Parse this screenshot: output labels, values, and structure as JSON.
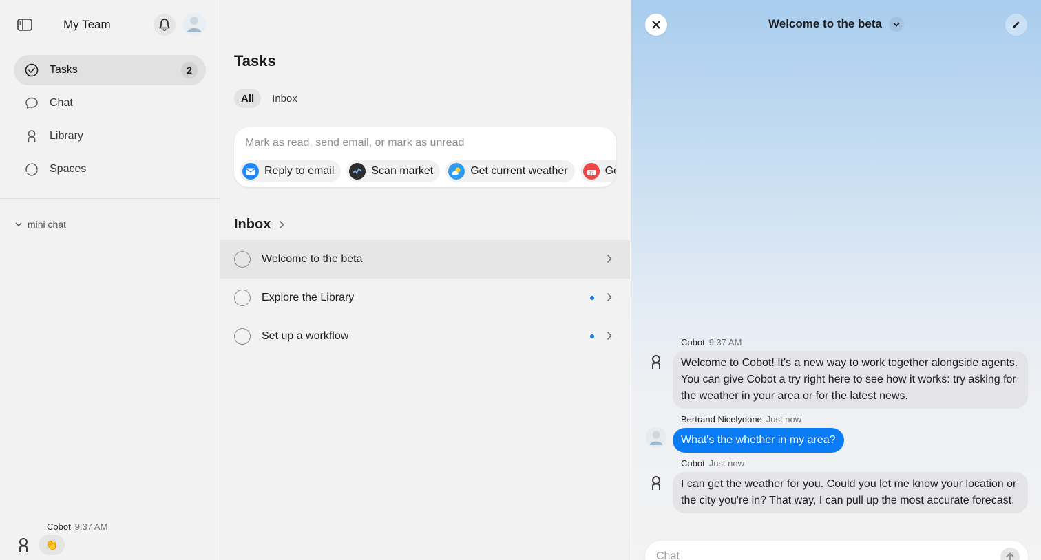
{
  "sidebar": {
    "team_name": "My Team",
    "nav": [
      {
        "label": "Tasks",
        "badge": "2"
      },
      {
        "label": "Chat"
      },
      {
        "label": "Library"
      },
      {
        "label": "Spaces"
      }
    ],
    "section_label": "mini chat",
    "last_message": {
      "sender": "Cobot",
      "time": "9:37 AM",
      "emoji": "👏"
    }
  },
  "main": {
    "title": "Tasks",
    "tabs": [
      {
        "label": "All",
        "active": true
      },
      {
        "label": "Inbox",
        "active": false
      }
    ],
    "command": {
      "placeholder": "Mark as read, send email, or mark as unread",
      "chips": [
        {
          "label": "Reply to email",
          "icon": "mail-icon",
          "color": "#1e88ff"
        },
        {
          "label": "Scan market",
          "icon": "market-icon",
          "color": "#2d2d2f"
        },
        {
          "label": "Get current weather",
          "icon": "weather-icon",
          "color": "#2f9bf0"
        },
        {
          "label": "Get e",
          "icon": "calendar-icon",
          "color": "#f04848"
        }
      ]
    },
    "inbox": {
      "heading": "Inbox",
      "items": [
        {
          "label": "Welcome to the beta",
          "unread": false,
          "selected": true
        },
        {
          "label": "Explore the Library",
          "unread": true,
          "selected": false
        },
        {
          "label": "Set up a workflow",
          "unread": true,
          "selected": false
        }
      ]
    }
  },
  "conversation": {
    "title": "Welcome to the beta",
    "messages": [
      {
        "sender": "Cobot",
        "time": "9:37 AM",
        "text": "Welcome to Cobot! It's a new way to work together alongside agents. You can give Cobot a try right here to see how it works: try asking for the weather in your area or for the latest news.",
        "me": false
      },
      {
        "sender": "Bertrand Nicelydone",
        "time": "Just now",
        "text": "What's the whether in my area?",
        "me": true
      },
      {
        "sender": "Cobot",
        "time": "Just now",
        "text": "I can get the weather for you. Could you let me know your location or the city you're in? That way, I can pull up the most accurate forecast.",
        "me": false
      }
    ],
    "input_placeholder": "Chat"
  },
  "colors": {
    "accent": "#0a7cf5",
    "unread_dot": "#1a73e8"
  }
}
